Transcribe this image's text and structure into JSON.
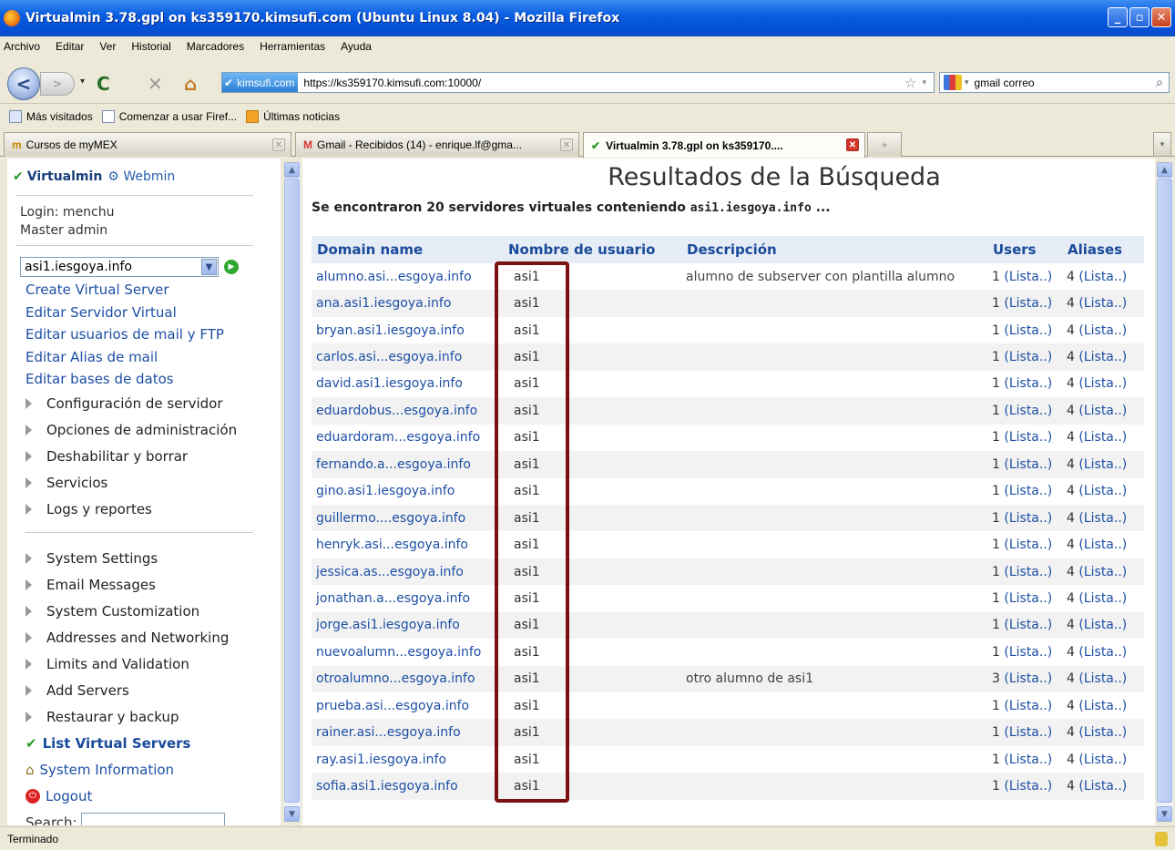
{
  "window": {
    "title": "Virtualmin 3.78.gpl on ks359170.kimsufi.com (Ubuntu Linux 8.04) - Mozilla Firefox"
  },
  "menubar": [
    "Archivo",
    "Editar",
    "Ver",
    "Historial",
    "Marcadores",
    "Herramientas",
    "Ayuda"
  ],
  "navbar": {
    "identity": "kimsufi.com",
    "url": "https://ks359170.kimsufi.com:10000/",
    "search_value": "gmail correo"
  },
  "bookmarks": [
    "Más visitados",
    "Comenzar a usar Firef...",
    "Últimas noticias"
  ],
  "tabs": [
    {
      "label": "Cursos de myMEX"
    },
    {
      "label": "Gmail - Recibidos (14) - enrique.lf@gma..."
    },
    {
      "label": "Virtualmin 3.78.gpl on ks359170...."
    }
  ],
  "sidebar": {
    "virtualmin": "Virtualmin",
    "webmin": "Webmin",
    "login": "Login: menchu",
    "role": "Master admin",
    "selected_domain": "asi1.iesgoya.info",
    "links": [
      "Create Virtual Server",
      "Editar Servidor Virtual",
      "Editar usuarios de mail y FTP",
      "Editar Alias de mail",
      "Editar bases de datos"
    ],
    "categories": [
      "Configuración de servidor",
      "Opciones de administración",
      "Deshabilitar y borrar",
      "Servicios",
      "Logs y reportes"
    ],
    "categories2": [
      "System Settings",
      "Email Messages",
      "System Customization",
      "Addresses and Networking",
      "Limits and Validation",
      "Add Servers",
      "Restaurar y backup"
    ],
    "active": "List Virtual Servers",
    "system_info": "System Information",
    "logout": "Logout",
    "search_label": "Search:"
  },
  "main": {
    "title": "Resultados de la Búsqueda",
    "found_prefix": "Se encontraron 20 servidores virtuales conteniendo",
    "found_query": "asi1.iesgoya.info",
    "found_suffix": "...",
    "headers": {
      "domain": "Domain name",
      "user": "Nombre de usuario",
      "desc": "Descripción",
      "users": "Users",
      "aliases": "Aliases"
    },
    "rows": [
      {
        "domain": "alumno.asi...esgoya.info",
        "user": "asi1",
        "desc": "alumno de subserver con plantilla alumno",
        "users": "1",
        "aliases": "4"
      },
      {
        "domain": "ana.asi1.iesgoya.info",
        "user": "asi1",
        "desc": "",
        "users": "1",
        "aliases": "4"
      },
      {
        "domain": "bryan.asi1.iesgoya.info",
        "user": "asi1",
        "desc": "",
        "users": "1",
        "aliases": "4"
      },
      {
        "domain": "carlos.asi...esgoya.info",
        "user": "asi1",
        "desc": "",
        "users": "1",
        "aliases": "4"
      },
      {
        "domain": "david.asi1.iesgoya.info",
        "user": "asi1",
        "desc": "",
        "users": "1",
        "aliases": "4"
      },
      {
        "domain": "eduardobus...esgoya.info",
        "user": "asi1",
        "desc": "",
        "users": "1",
        "aliases": "4"
      },
      {
        "domain": "eduardoram...esgoya.info",
        "user": "asi1",
        "desc": "",
        "users": "1",
        "aliases": "4"
      },
      {
        "domain": "fernando.a...esgoya.info",
        "user": "asi1",
        "desc": "",
        "users": "1",
        "aliases": "4"
      },
      {
        "domain": "gino.asi1.iesgoya.info",
        "user": "asi1",
        "desc": "",
        "users": "1",
        "aliases": "4"
      },
      {
        "domain": "guillermo....esgoya.info",
        "user": "asi1",
        "desc": "",
        "users": "1",
        "aliases": "4"
      },
      {
        "domain": "henryk.asi...esgoya.info",
        "user": "asi1",
        "desc": "",
        "users": "1",
        "aliases": "4"
      },
      {
        "domain": "jessica.as...esgoya.info",
        "user": "asi1",
        "desc": "",
        "users": "1",
        "aliases": "4"
      },
      {
        "domain": "jonathan.a...esgoya.info",
        "user": "asi1",
        "desc": "",
        "users": "1",
        "aliases": "4"
      },
      {
        "domain": "jorge.asi1.iesgoya.info",
        "user": "asi1",
        "desc": "",
        "users": "1",
        "aliases": "4"
      },
      {
        "domain": "nuevoalumn...esgoya.info",
        "user": "asi1",
        "desc": "",
        "users": "1",
        "aliases": "4"
      },
      {
        "domain": "otroalumno...esgoya.info",
        "user": "asi1",
        "desc": "otro alumno de asi1",
        "users": "3",
        "aliases": "4"
      },
      {
        "domain": "prueba.asi...esgoya.info",
        "user": "asi1",
        "desc": "",
        "users": "1",
        "aliases": "4"
      },
      {
        "domain": "rainer.asi...esgoya.info",
        "user": "asi1",
        "desc": "",
        "users": "1",
        "aliases": "4"
      },
      {
        "domain": "ray.asi1.iesgoya.info",
        "user": "asi1",
        "desc": "",
        "users": "1",
        "aliases": "4"
      },
      {
        "domain": "sofia.asi1.iesgoya.info",
        "user": "asi1",
        "desc": "",
        "users": "1",
        "aliases": "4"
      }
    ],
    "lista_label": "(Lista..)"
  },
  "status": {
    "text": "Terminado"
  },
  "colors": {
    "link": "#1d4fa5",
    "header_bg": "#e7edf6",
    "highlight": "#7a1010"
  }
}
